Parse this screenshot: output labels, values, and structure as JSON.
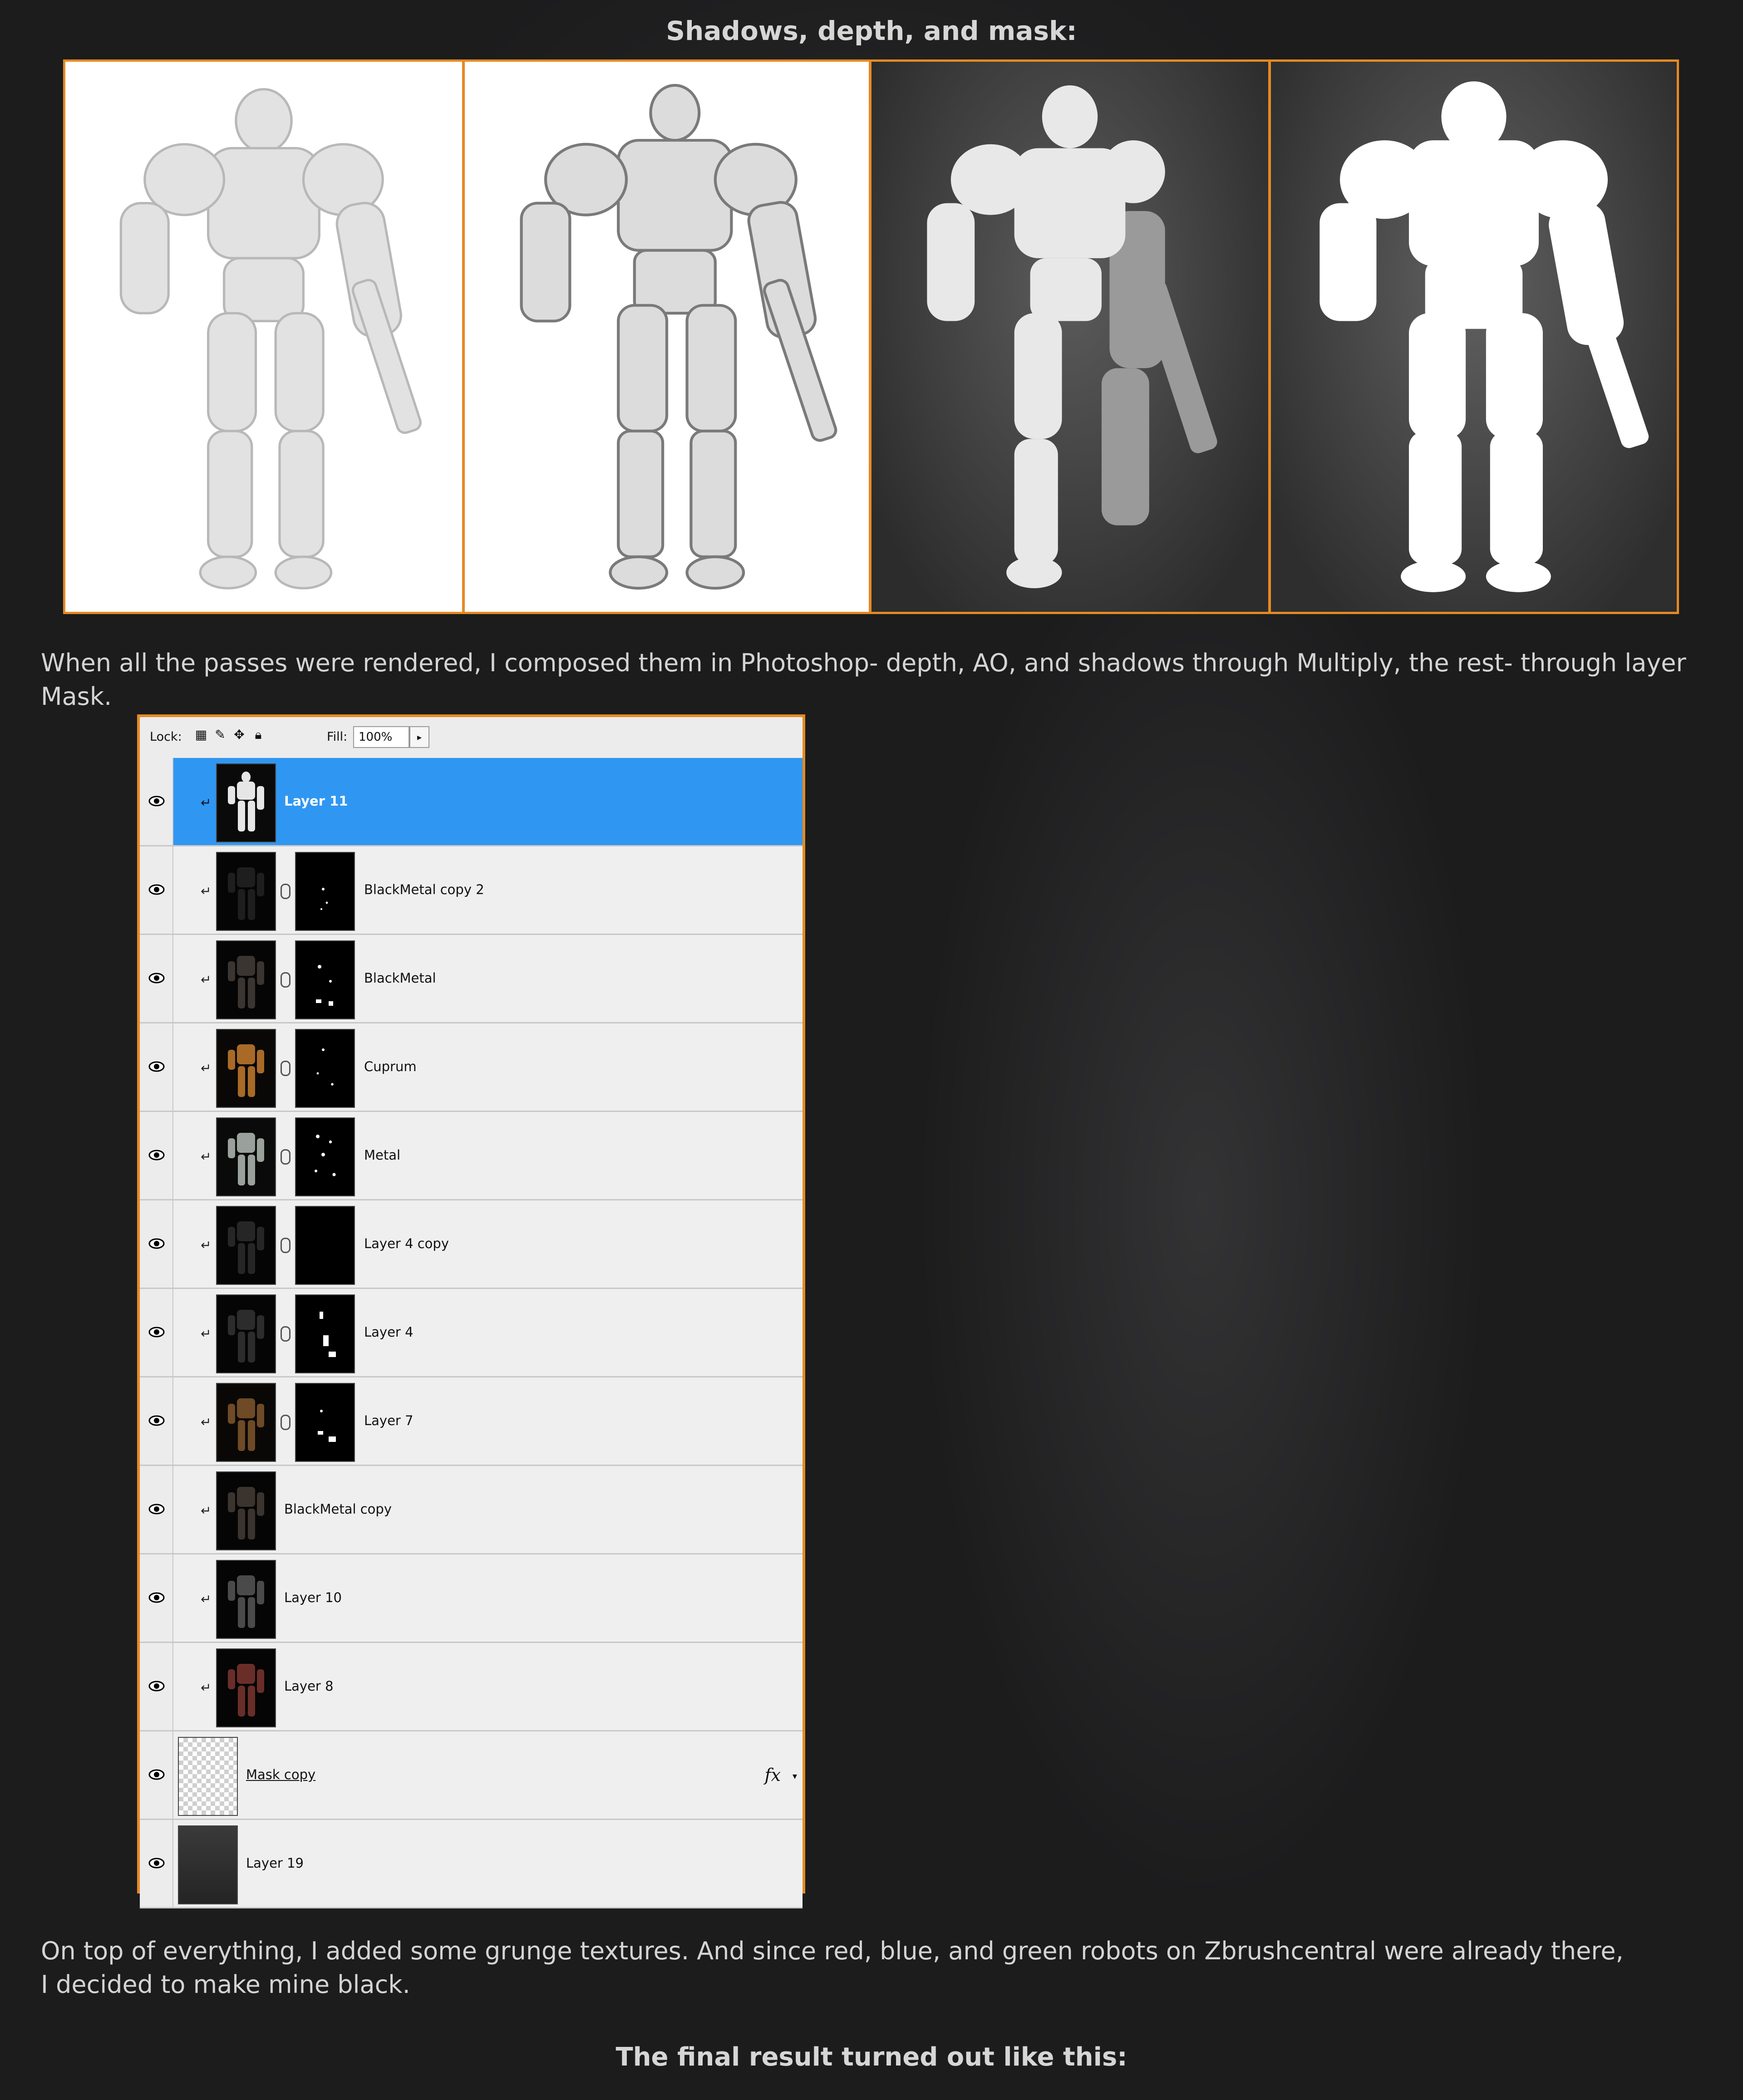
{
  "headings": {
    "passes": "Shadows, depth, and mask:",
    "final": "The final result turned out like this:"
  },
  "paragraphs": {
    "compose": "When all the passes were rendered, I composed them in Photoshop- depth, AO, and shadows through Multiply, the rest- through layer Mask.",
    "grunge_line1": "On top of everything, I added some grunge textures. And since red, blue, and green robots on Zbrushcentral were already there,",
    "grunge_line2": "I decided to make mine black."
  },
  "panel": {
    "lock_label": "Lock:",
    "fill_label": "Fill:",
    "fill_value": "100%",
    "layers": [
      {
        "name": "Layer 11",
        "selected": true,
        "mask": false
      },
      {
        "name": "BlackMetal copy 2",
        "mask": true
      },
      {
        "name": "BlackMetal",
        "mask": true
      },
      {
        "name": "Cuprum",
        "mask": true
      },
      {
        "name": "Metal",
        "mask": true
      },
      {
        "name": "Layer 4 copy",
        "mask": true
      },
      {
        "name": "Layer 4",
        "mask": true
      },
      {
        "name": "Layer 7",
        "mask": true
      },
      {
        "name": "BlackMetal copy",
        "mask": false
      },
      {
        "name": "Layer 10",
        "mask": false
      },
      {
        "name": "Layer 8",
        "mask": false
      },
      {
        "name": "Mask copy",
        "mask": false,
        "fx": "fx"
      },
      {
        "name": "Layer 19",
        "mask": false
      }
    ]
  },
  "colors": {
    "accent_border": "#e58a22",
    "selection": "#2f97f2",
    "background": "#1c1c1d"
  }
}
